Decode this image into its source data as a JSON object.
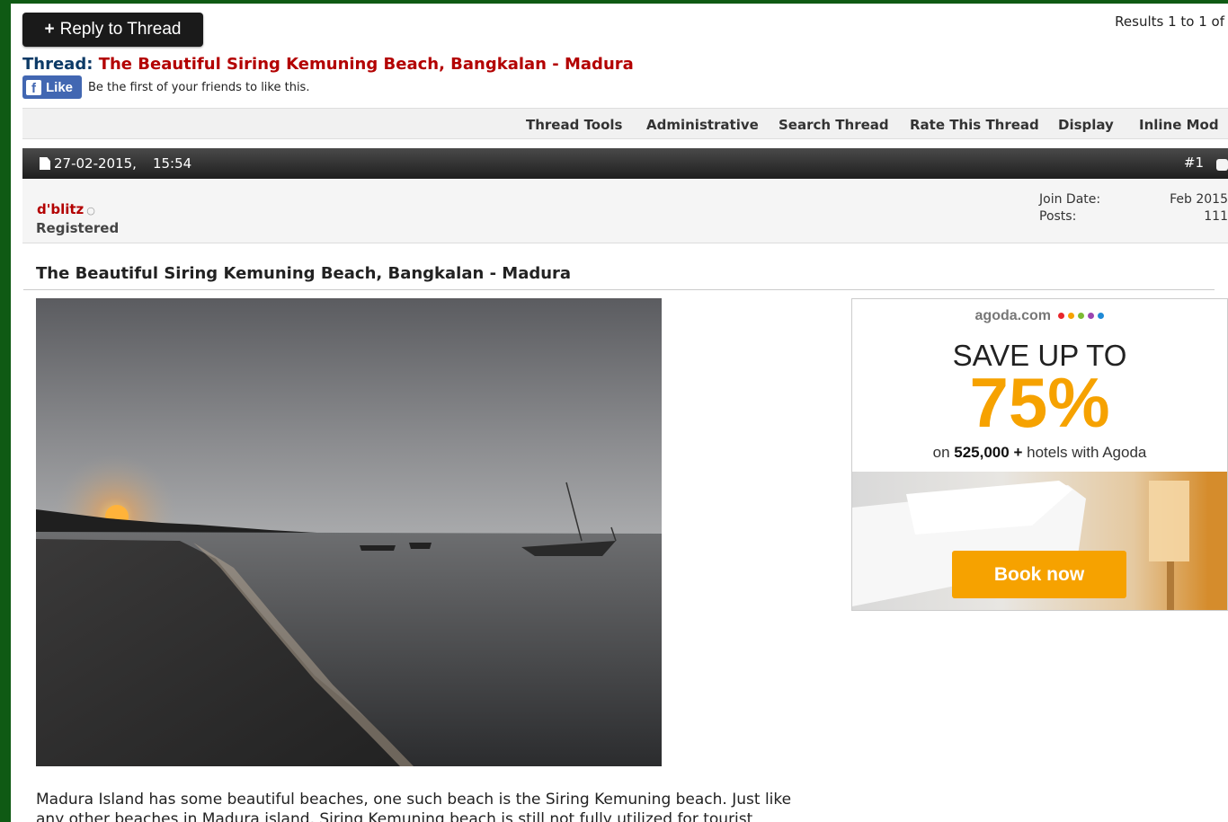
{
  "header": {
    "reply_label": "Reply to Thread",
    "results": "Results 1 to 1 of"
  },
  "thread": {
    "prefix": "Thread:",
    "title": "The Beautiful Siring Kemuning Beach, Bangkalan - Madura"
  },
  "facebook": {
    "like_label": "Like",
    "social_text": "Be the first of your friends to like this."
  },
  "toolbar": {
    "items": [
      "Thread Tools",
      "Administrative",
      "Search Thread",
      "Rate This Thread",
      "Display",
      "Inline Mod"
    ]
  },
  "post": {
    "date": "27-02-2015,",
    "time": "15:54",
    "number": "#1",
    "username": "d'blitz",
    "user_title": "Registered",
    "join_date_label": "Join Date:",
    "join_date": "Feb 2015",
    "posts_label": "Posts:",
    "posts": "111",
    "title": "The Beautiful Siring Kemuning Beach, Bangkalan - Madura",
    "body_line1": "Madura Island has some beautiful beaches, one such beach is the Siring Kemuning beach. Just like",
    "body_line2": "any other beaches in Madura island, Siring Kemuning beach is still not fully utilized for tourist"
  },
  "ad": {
    "brand": "agoda.com",
    "dot_colors": [
      "#e8262b",
      "#f6a200",
      "#7dbb33",
      "#9b45b0",
      "#1f8ad6"
    ],
    "headline": "SAVE UP TO",
    "percent": "75%",
    "on": "on",
    "count": "525,000 +",
    "tail": "hotels with Agoda",
    "cta": "Book now"
  },
  "colors": {
    "background": "#0f5a14",
    "accent_red": "#b30000",
    "agoda_orange": "#f6a200"
  }
}
